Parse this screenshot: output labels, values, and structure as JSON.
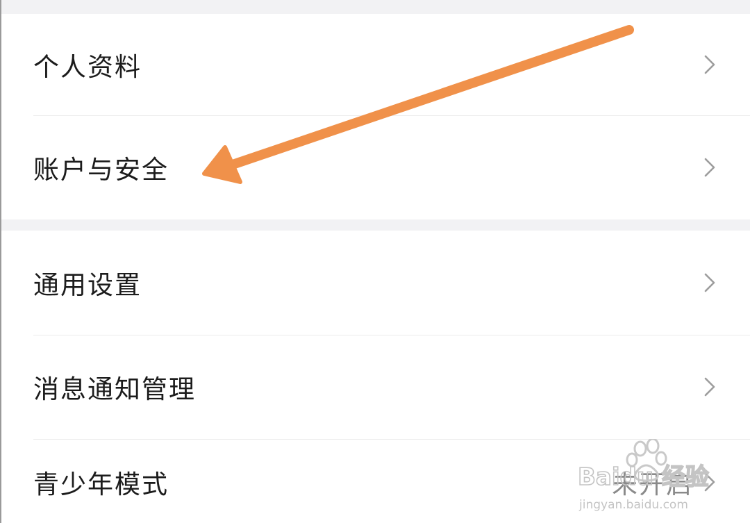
{
  "settings": {
    "group1": [
      {
        "label": "个人资料",
        "icon": "chevron-right-icon"
      },
      {
        "label": "账户与安全",
        "icon": "chevron-right-icon"
      }
    ],
    "group2": [
      {
        "label": "通用设置",
        "icon": "chevron-right-icon"
      },
      {
        "label": "消息通知管理",
        "icon": "chevron-right-icon"
      },
      {
        "label": "青少年模式",
        "value": "未开启",
        "icon": "chevron-right-icon"
      }
    ]
  },
  "annotation": {
    "arrow_color": "#f0914a",
    "arrow_icon": "arrow-annotation"
  },
  "watermark": {
    "brand": "Baidu 经验",
    "url": "jingyan.baidu.com"
  }
}
